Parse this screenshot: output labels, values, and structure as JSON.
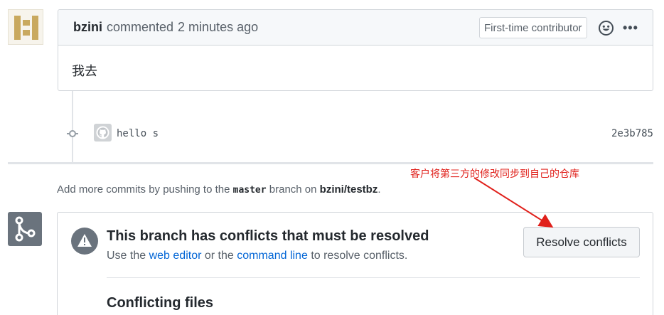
{
  "comment": {
    "author": "bzini",
    "action": "commented",
    "time": "2 minutes ago",
    "badge": "First-time contributor",
    "more": "•••",
    "body": "我去"
  },
  "commit": {
    "message": "hello s",
    "sha": "2e3b785"
  },
  "annotation": "客户将第三方的修改同步到自己的仓库",
  "add_more": {
    "prefix": "Add more commits by pushing to the",
    "branch": "master",
    "middle": "branch on",
    "repo": "bzini/testbz",
    "suffix": "."
  },
  "merge": {
    "title": "This branch has conflicts that must be resolved",
    "sub_prefix": "Use the",
    "web_editor": "web editor",
    "sub_middle": "or the",
    "command_line": "command line",
    "sub_suffix": "to resolve conflicts.",
    "resolve_button": "Resolve conflicts",
    "conflicting_files": "Conflicting files"
  },
  "icons": {
    "avatar": "identicon-avatar",
    "emoji": "smiley-icon",
    "commit": "git-commit-icon",
    "commit_avatar": "github-octocat-avatar",
    "merge": "git-merge-icon",
    "warning": "alert-icon"
  },
  "colors": {
    "annotation": "#e0201b",
    "link": "#0366d6"
  }
}
